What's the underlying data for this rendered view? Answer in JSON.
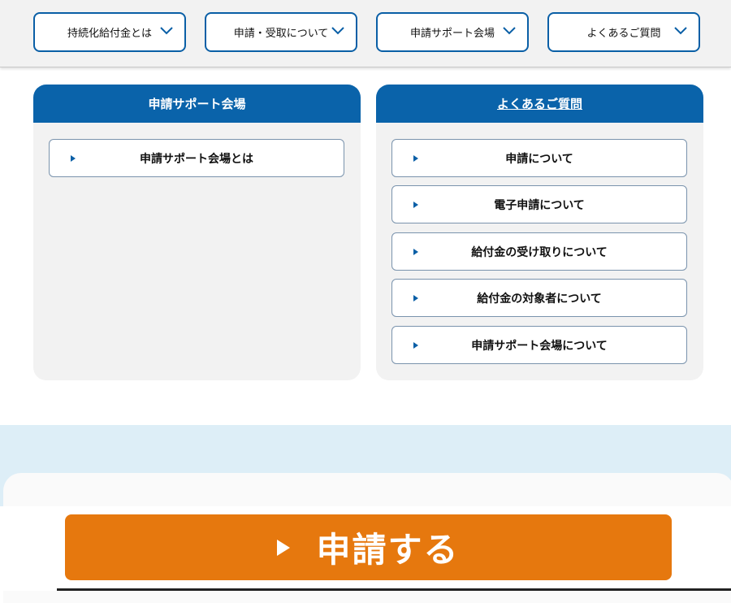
{
  "nav": {
    "items": [
      {
        "label": "持続化給付金とは",
        "icon": "chevron-down-icon"
      },
      {
        "label": "申請・受取について",
        "icon": "chevron-down-icon"
      },
      {
        "label": "申請サポート会場",
        "icon": "chevron-down-icon"
      },
      {
        "label": "よくあるご質問",
        "icon": "chevron-down-icon"
      }
    ]
  },
  "panels": {
    "support": {
      "title": "申請サポート会場",
      "items": [
        "申請サポート会場とは"
      ]
    },
    "faq": {
      "title": "よくあるご質問",
      "items": [
        "申請について",
        "電子申請について",
        "給付金の受け取りについて",
        "給付金の対象者について",
        "申請サポート会場について"
      ]
    }
  },
  "cta": {
    "label": "申請する",
    "icon": "play-icon"
  },
  "colors": {
    "brand_blue": "#0a63aa",
    "cta_orange": "#e6780e",
    "panel_bg": "#f2f2f2",
    "band_bg": "#ddeef7"
  }
}
